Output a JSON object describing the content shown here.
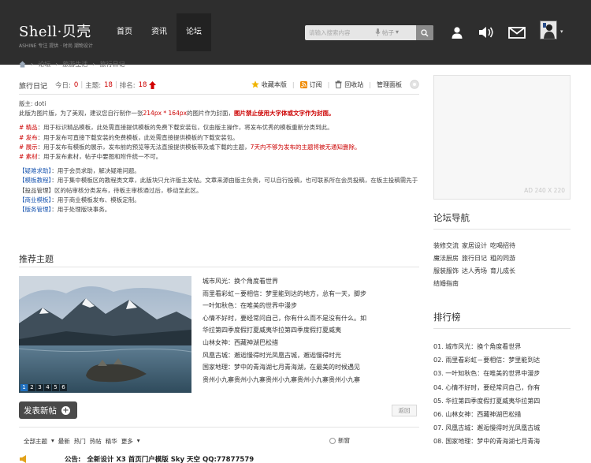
{
  "header": {
    "logo_main": "Shell·贝壳",
    "logo_sub": "ASHINE 专注 提供 · 时尚 潮物设计",
    "nav": [
      "首页",
      "资讯",
      "论坛"
    ],
    "search_placeholder": "请输入搜索内容",
    "search_type": "帖子"
  },
  "breadcrumb": [
    "论坛",
    "旅游生活",
    "旅行日记"
  ],
  "forum": {
    "title": "旅行日记",
    "today_label": "今日:",
    "today_value": "0",
    "topics_label": "主题:",
    "topics_value": "18",
    "rank_label": "排名:",
    "rank_value": "18",
    "actions": [
      "收藏本版",
      "订阅",
      "回收站",
      "管理面板"
    ]
  },
  "info": {
    "moderator": "版主: doti",
    "line1_a": "此版为图片版，为了美观，建议您自行制作一张",
    "line1_size": "214px * 164px",
    "line1_b": "的图片作为封面，",
    "line1_warn": "图片禁止使用大字体或文字作为封面。",
    "tags": [
      {
        "key": "# 精品",
        "text": "：用于标识精品模板，此处需直接提供模板的免费下载安装包，仅由版主操作，将发布优秀的模板重新分类到此。"
      },
      {
        "key": "# 发布",
        "text": "：用于发布可直接下载安装的免费模板，此处需直接提供模板的下载安装包。"
      },
      {
        "key": "# 展示",
        "text": "：用于发布有模板的展示，发布前的预览等无法直接提供模板带及或下载的主题，",
        "warn": "7天内不够为发布的主题将被无通知删除。"
      },
      {
        "key": "# 素材",
        "text": "：用于发布素材，帖子中要图和附件统一不可。"
      }
    ],
    "help": [
      {
        "key": "【疑难求助】",
        "text": "：用于会员求助，解决疑难问题。"
      },
      {
        "key": "【模板教程】",
        "text": "：用于集中模板区的教程类文章，此版块只允许版主发帖。文章来源由版主负责，可以自行投稿，也可联系所在会员投稿，在板主投稿需先于【投品管理】区的帖审核分类发布，待板主审核通过后，移动至此区。"
      },
      {
        "key": "【商业模板】",
        "text": "：用于商业模板发布、模板定制。"
      },
      {
        "key": "【版务管理】",
        "text": "：用于处理版块事务。"
      }
    ]
  },
  "recommend": {
    "title": "推荐主题",
    "slide_numbers": [
      "1",
      "2",
      "3",
      "4",
      "5",
      "6"
    ],
    "items": [
      "城市风光：换个角度看世界",
      "雨里看彩虹－要相信：梦里能到达的地方，总有一天，脚步",
      "一叶知秋色：在唯美的世界中漫步",
      "心情不好时，要经常问自己，你有什么而不是没有什么。如",
      "华拉第四季度假打夏威夷华拉第四季度假打夏威夷",
      "山林女神：西藏神湖巴松措",
      "风凰古城：邂逅慢得时光凤凰古城，邂逅慢得时光",
      "国家地理：梦中的青海湖七月青海湖，在最美的时候遇见",
      "贵州小九寨贵州小九寨贵州小九寨贵州小九寨贵州小九寨"
    ]
  },
  "list": {
    "post_label": "发表新帖",
    "return_label": "返回",
    "filters": [
      "全部主题",
      "▾",
      "最新",
      "热门",
      "热帖",
      "精华",
      "更多",
      "▾"
    ],
    "newwin_label": "新窗",
    "announce_label": "公告:",
    "announce_text": "全新设计 X3 首页门户模版 Sky 天空 QQ:77877579"
  },
  "sidebar": {
    "ad_label": "AD 240 X 220",
    "nav_title": "论坛导航",
    "nav_links": [
      "装修交流",
      "家居设计",
      "吃喝招待",
      "魔法厨房",
      "旅行日记",
      "粗的同游",
      "服装服饰",
      "达人秀场",
      "育儿成长",
      "结婚指南"
    ],
    "rank_title": "排行榜",
    "ranks": [
      "01. 城市风光：换个角度看世界",
      "02. 雨里看彩虹－要相信：梦里能到达",
      "03. 一叶知秋色：在唯美的世界中漫步",
      "04. 心情不好时，要经常问自己，你有",
      "05. 华拉第四季度假打夏威夷华拉第四",
      "06. 山林女神：西藏神湖巴松措",
      "07. 风凰古城：邂逅慢得时光凤凰古城",
      "08. 国家地理：梦中的青海湖七月青海"
    ]
  },
  "colors": {
    "topbar": "#2e2e2e",
    "accent_red": "#cc0000",
    "link_blue": "#1a56b0"
  }
}
